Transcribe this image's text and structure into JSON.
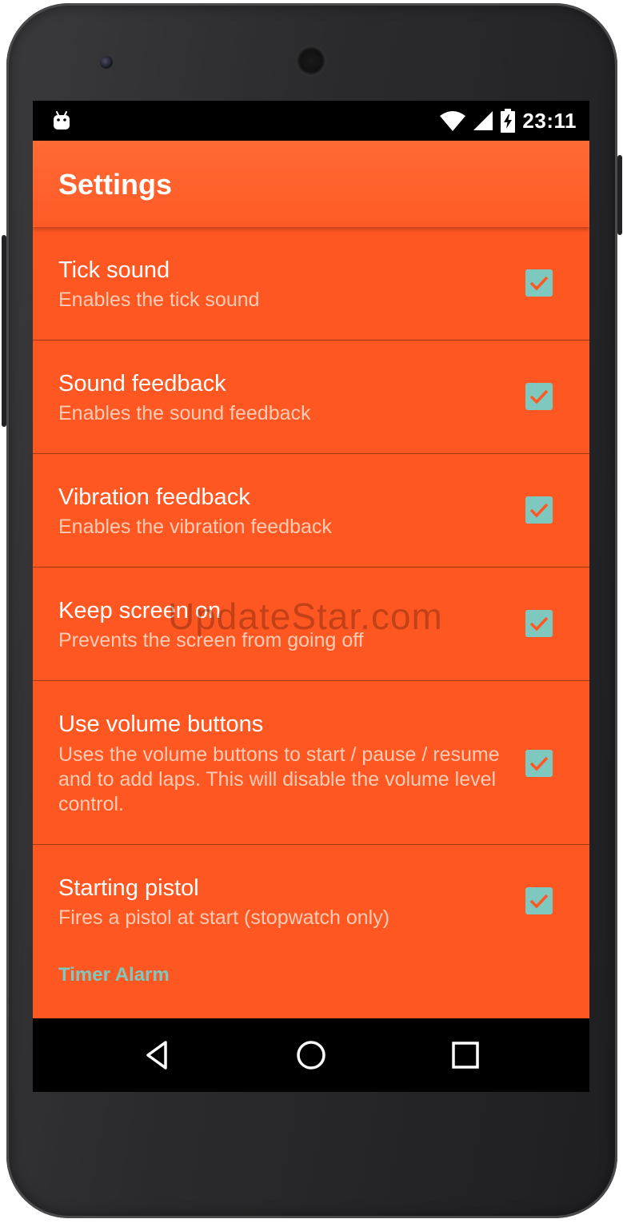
{
  "status_bar": {
    "time": "23:11",
    "icons": [
      "android-icon",
      "wifi-icon",
      "signal-icon",
      "battery-charging-icon"
    ]
  },
  "app_bar": {
    "title": "Settings"
  },
  "preferences": [
    {
      "title": "Tick sound",
      "summary": "Enables the tick sound",
      "checked": true
    },
    {
      "title": "Sound feedback",
      "summary": "Enables the sound feedback",
      "checked": true
    },
    {
      "title": "Vibration feedback",
      "summary": "Enables the vibration feedback",
      "checked": true
    },
    {
      "title": "Keep screen on",
      "summary": "Prevents the screen from going off",
      "checked": true
    },
    {
      "title": "Use volume buttons",
      "summary": "Uses the volume buttons to start / pause / resume and to add laps. This will disable the volume level control.",
      "checked": true
    },
    {
      "title": "Starting pistol",
      "summary": "Fires a pistol at start (stopwatch only)",
      "checked": true
    }
  ],
  "section_header": "Timer Alarm",
  "nav_bar": {
    "buttons": [
      "back-icon",
      "home-icon",
      "recents-icon"
    ]
  },
  "watermark": "UpdateStar.com",
  "colors": {
    "primary": "#ff5722",
    "accent": "#7ec8c0",
    "status_bar": "#000000"
  }
}
